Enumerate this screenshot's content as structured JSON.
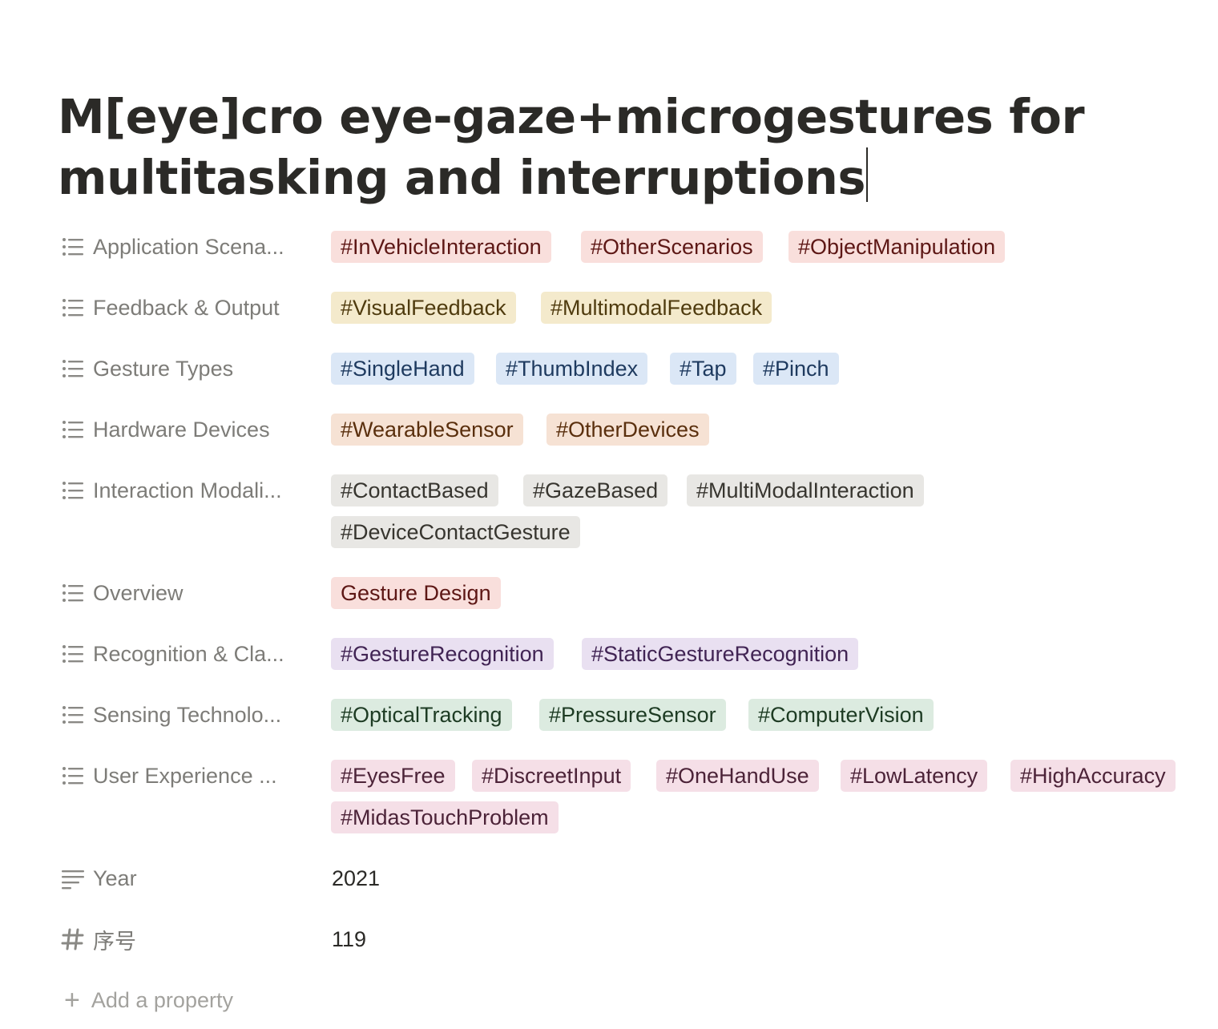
{
  "title": "M[eye]cro eye-gaze+microgestures for multitasking and interruptions",
  "properties": [
    {
      "label": "Application Scena...",
      "icon": "list-icon",
      "tags": [
        {
          "text": "#InVehicleInteraction",
          "color": "#f9dfdc"
        },
        {
          "text": "#OtherScenarios",
          "color": "#f9dfdc"
        },
        {
          "text": "#ObjectManipulation",
          "color": "#f9dfdc"
        }
      ]
    },
    {
      "label": "Feedback & Output",
      "icon": "list-icon",
      "tags": [
        {
          "text": "#VisualFeedback",
          "color": "#f4eacc"
        },
        {
          "text": "#MultimodalFeedback",
          "color": "#f4eacc"
        }
      ]
    },
    {
      "label": "Gesture Types",
      "icon": "list-icon",
      "tags": [
        {
          "text": "#SingleHand",
          "color": "#dbe7f6"
        },
        {
          "text": "#ThumbIndex",
          "color": "#dbe7f6"
        },
        {
          "text": "#Tap",
          "color": "#dbe7f6"
        },
        {
          "text": "#Pinch",
          "color": "#dbe7f6"
        }
      ]
    },
    {
      "label": "Hardware Devices",
      "icon": "list-icon",
      "tags": [
        {
          "text": "#WearableSensor",
          "color": "#f6e2d4"
        },
        {
          "text": "#OtherDevices",
          "color": "#f6e2d4"
        }
      ]
    },
    {
      "label": "Interaction Modali...",
      "icon": "list-icon",
      "tags": [
        {
          "text": "#ContactBased",
          "color": "#e8e7e4"
        },
        {
          "text": "#GazeBased",
          "color": "#e8e7e4"
        },
        {
          "text": "#MultiModalInteraction",
          "color": "#e8e7e4"
        },
        {
          "text": "#DeviceContactGesture",
          "color": "#e8e7e4"
        }
      ]
    },
    {
      "label": "Overview",
      "icon": "list-icon",
      "tags": [
        {
          "text": "Gesture Design",
          "color": "#f9dfdc"
        }
      ]
    },
    {
      "label": "Recognition & Cla...",
      "icon": "list-icon",
      "tags": [
        {
          "text": "#GestureRecognition",
          "color": "#e9e0f1"
        },
        {
          "text": "#StaticGestureRecognition",
          "color": "#e9e0f1"
        }
      ]
    },
    {
      "label": "Sensing Technolo...",
      "icon": "list-icon",
      "tags": [
        {
          "text": "#OpticalTracking",
          "color": "#dcebe0"
        },
        {
          "text": "#PressureSensor",
          "color": "#dcebe0"
        },
        {
          "text": "#ComputerVision",
          "color": "#dcebe0"
        }
      ]
    },
    {
      "label": "User Experience ...",
      "icon": "list-icon",
      "tags": [
        {
          "text": "#EyesFree",
          "color": "#f5dfe7"
        },
        {
          "text": "#DiscreetInput",
          "color": "#f5dfe7"
        },
        {
          "text": "#OneHandUse",
          "color": "#f5dfe7"
        },
        {
          "text": "#LowLatency",
          "color": "#f5dfe7"
        },
        {
          "text": "#HighAccuracy",
          "color": "#f5dfe7"
        },
        {
          "text": "#MidasTouchProblem",
          "color": "#f5dfe7"
        }
      ]
    },
    {
      "label": "Year",
      "icon": "text-icon",
      "value": "2021"
    },
    {
      "label": "序号",
      "icon": "number-icon",
      "value": "119"
    }
  ],
  "add_property": "Add a property"
}
